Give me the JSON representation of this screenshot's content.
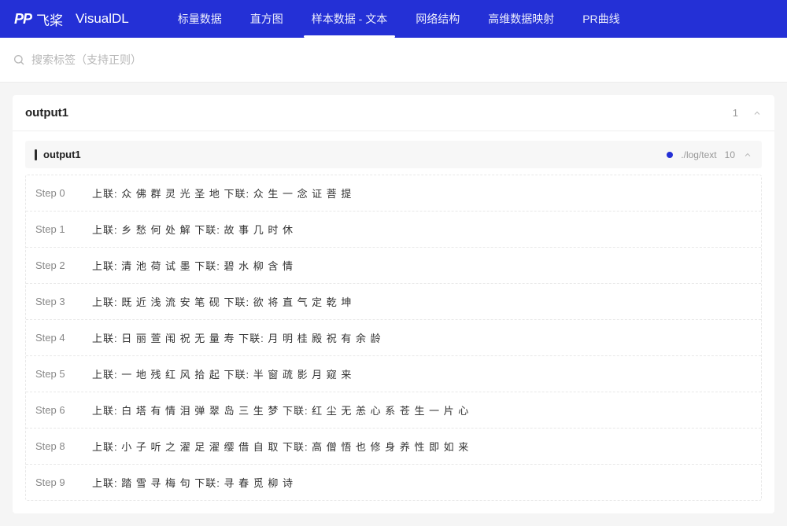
{
  "header": {
    "logo_mark": "PP",
    "logo_cn": "飞桨",
    "app_name": "VisualDL",
    "nav": [
      {
        "label": "标量数据",
        "active": false
      },
      {
        "label": "直方图",
        "active": false
      },
      {
        "label": "样本数据 - 文本",
        "active": true
      },
      {
        "label": "网络结构",
        "active": false
      },
      {
        "label": "高维数据映射",
        "active": false
      },
      {
        "label": "PR曲线",
        "active": false
      }
    ]
  },
  "search": {
    "placeholder": "搜索标签（支持正则）"
  },
  "panel": {
    "title": "output1",
    "count": "1",
    "tag": {
      "name": "output1",
      "run_path": "./log/text",
      "run_count": "10"
    },
    "steps": [
      {
        "label": "Step 0",
        "text": "上联: 众 佛 群 灵 光 圣 地 下联: 众 生 一 念 证 菩 提"
      },
      {
        "label": "Step 1",
        "text": "上联: 乡 愁 何 处 解 下联: 故 事 几 时 休"
      },
      {
        "label": "Step 2",
        "text": "上联: 清 池 荷 试 墨 下联: 碧 水 柳 含 情"
      },
      {
        "label": "Step 3",
        "text": "上联: 既 近 浅 流 安 笔 砚 下联: 欲 将 直 气 定 乾 坤"
      },
      {
        "label": "Step 4",
        "text": "上联: 日 丽 萱 闱 祝 无 量 寿 下联: 月 明 桂 殿 祝 有 余 龄"
      },
      {
        "label": "Step 5",
        "text": "上联: 一 地 残 红 风 拾 起 下联: 半 窗 疏 影 月 窥 来"
      },
      {
        "label": "Step 6",
        "text": "上联: 白 塔 有 情 泪 弹 翠 岛 三 生 梦 下联: 红 尘 无 恙 心 系 苍 生 一 片 心"
      },
      {
        "label": "Step 8",
        "text": "上联: 小 子 听 之 濯 足 濯 缨 借 自 取 下联: 高 僧 悟 也 修 身 养 性 即 如 来"
      },
      {
        "label": "Step 9",
        "text": "上联: 踏 雪 寻 梅 句 下联: 寻 春 觅 柳 诗"
      }
    ]
  }
}
